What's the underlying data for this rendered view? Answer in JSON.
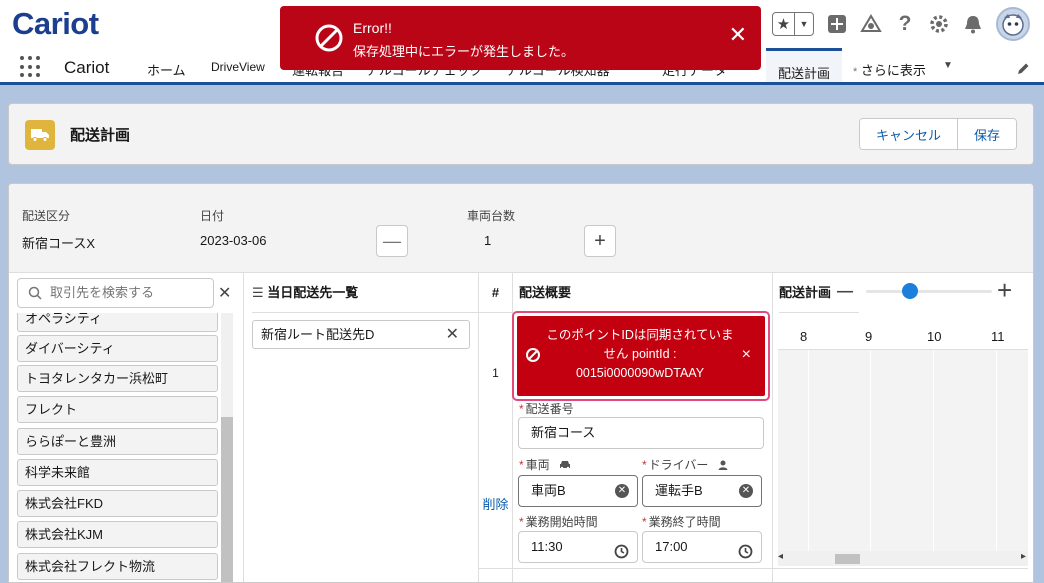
{
  "app": {
    "logo_text": "Cariot",
    "name": "Cariot"
  },
  "nav": {
    "items": [
      "ホーム",
      "DriveView",
      "運転報告",
      "アルコールチェック",
      "アルコール検知器",
      "走行データ"
    ],
    "active": "配送計画",
    "more_prefix": "*",
    "more": "さらに表示"
  },
  "toast": {
    "title": "Error!!",
    "message": "保存処理中にエラーが発生しました。",
    "close": "✕"
  },
  "page_header": {
    "title": "配送計画",
    "cancel": "キャンセル",
    "save": "保存"
  },
  "fields": {
    "delivery_section_label": "配送区分",
    "delivery_section_value": "新宿コースX",
    "date_label": "日付",
    "date_value": "2023-03-06",
    "vehicle_count_label": "車両台数",
    "vehicle_count_value": "1",
    "minus": "—",
    "plus": "+"
  },
  "accounts": {
    "search_placeholder": "取引先を検索する",
    "clear": "✕",
    "items": [
      "オペラシティ",
      "ダイバーシティ",
      "トヨタレンタカー浜松町",
      "フレクト",
      "ららぽーと豊洲",
      "科学未来館",
      "株式会社FKD",
      "株式会社KJM",
      "株式会社フレクト物流"
    ]
  },
  "destinations": {
    "header_icon": "☰",
    "header": "当日配送先一覧",
    "items": [
      "新宿ルート配送先D"
    ],
    "remove": "✕"
  },
  "plan_table": {
    "num_header": "#",
    "summary_header": "配送概要",
    "row_number": "1",
    "delete_link": "削除",
    "error_text": "このポイントIDは同期されていません pointId : 0015i0000090wDTAAY",
    "error_close": "×",
    "delivery_no_label": "配送番号",
    "delivery_no_value": "新宿コース",
    "vehicle_label": "車両",
    "vehicle_value": "車両B",
    "driver_label": "ドライバー",
    "driver_value": "運転手B",
    "start_label": "業務開始時間",
    "start_value": "11:30",
    "end_label": "業務終了時間",
    "end_value": "17:00"
  },
  "schedule": {
    "header": "配送計画",
    "zoom_minus": "—",
    "zoom_plus": "+",
    "zoom_level": 0.35,
    "hours": [
      "8",
      "9",
      "10",
      "11"
    ],
    "scroll_left": "◂",
    "scroll_right": "▸"
  },
  "colors": {
    "brand": "#1b3e8f",
    "error": "#ba0517",
    "link": "#0b5cab",
    "highlight_border": "#e24a7a",
    "object_icon": "#dfb53e"
  }
}
